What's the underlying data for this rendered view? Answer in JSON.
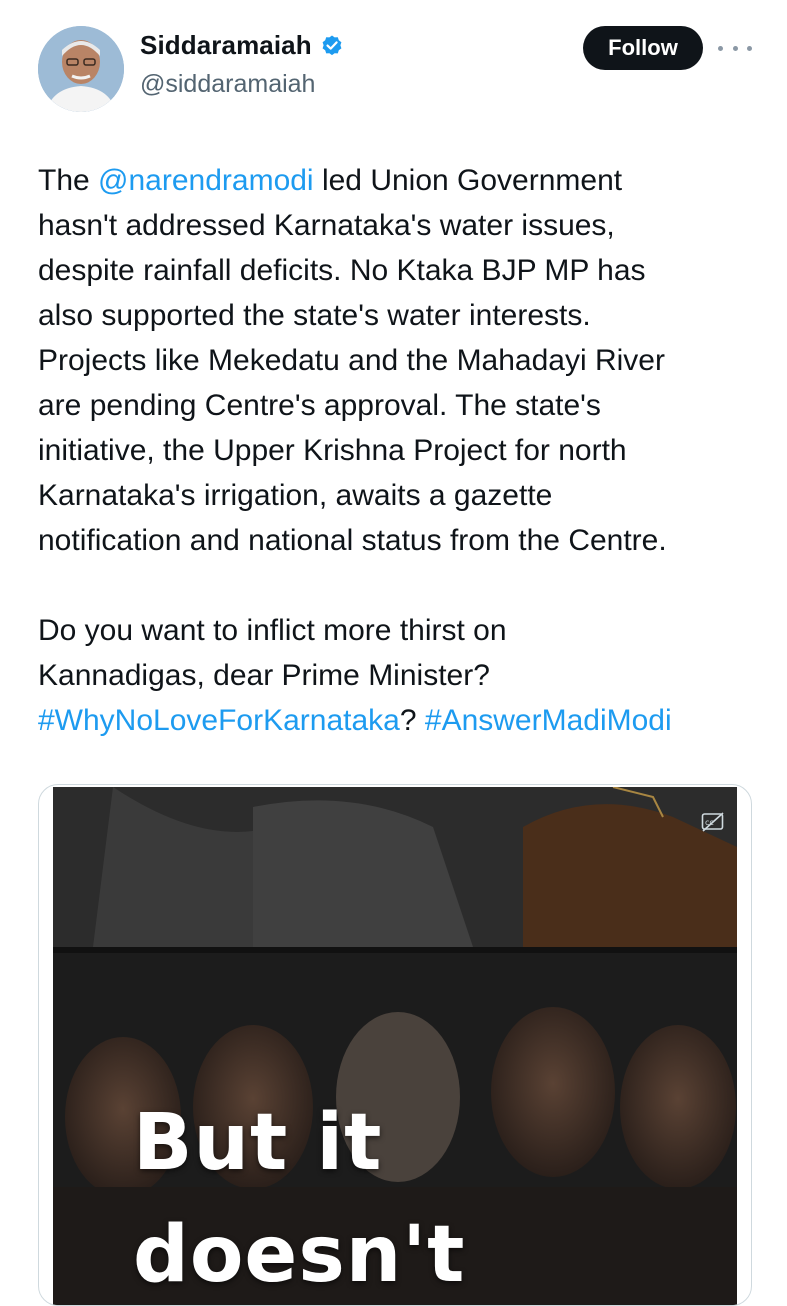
{
  "author": {
    "display_name": "Siddaramaiah",
    "handle": "@siddaramaiah",
    "verified": true,
    "verified_color": "#1d9bf0"
  },
  "actions": {
    "follow_label": "Follow"
  },
  "tweet": {
    "p1": {
      "l1_pre": "The ",
      "mention": "@narendramodi",
      "l1_post": " led Union Government",
      "l2": "hasn't addressed Karnataka's water issues,",
      "l3": "despite rainfall deficits. No Ktaka BJP MP has",
      "l4": "also supported the state's water interests.",
      "l5": "Projects like Mekedatu and the Mahadayi River",
      "l6": "are pending Centre's approval. The state's",
      "l7": "initiative, the Upper Krishna Project for north",
      "l8": "Karnataka's irrigation, awaits a gazette",
      "l9": "notification and national status from the Centre."
    },
    "p2": {
      "l1": "Do you want to inflict more thirst on",
      "l2": "Kannadigas, dear Prime Minister?",
      "hashtag1": "#WhyNoLoveForKarnataka",
      "between": "? ",
      "hashtag2": "#AnswerMadiModi"
    }
  },
  "media": {
    "overlay_text": "But it\ndoesn't",
    "caption_icon": "closed-captions-icon"
  },
  "colors": {
    "link": "#1d9bf0",
    "text": "#0f1419",
    "secondary": "#536471",
    "follow_bg": "#0f1419"
  }
}
